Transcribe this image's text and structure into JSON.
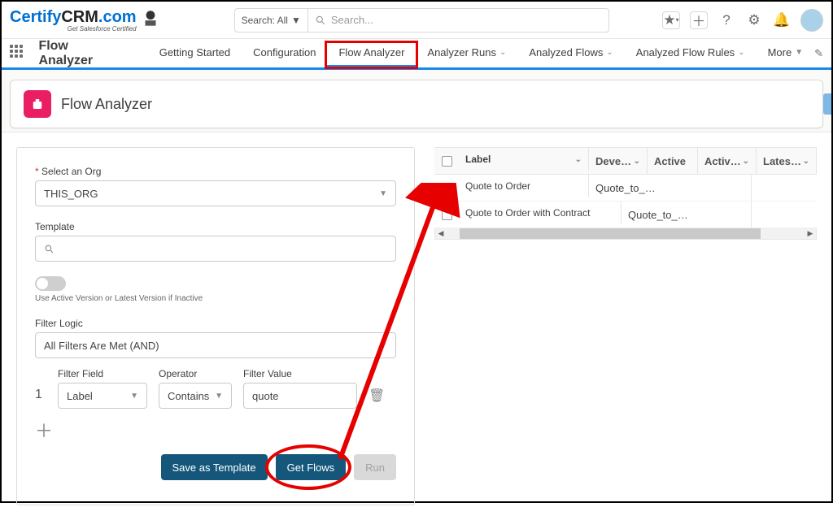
{
  "logo": {
    "brand_part1": "Certify",
    "brand_part2": "CRM",
    "brand_part3": ".com",
    "tagline": "Get Salesforce Certified"
  },
  "search": {
    "scope": "Search: All",
    "placeholder": "Search..."
  },
  "nav": {
    "app_name": "Flow Analyzer",
    "tabs": [
      {
        "label": "Getting Started",
        "dropdown": false,
        "active": false
      },
      {
        "label": "Configuration",
        "dropdown": false,
        "active": false
      },
      {
        "label": "Flow Analyzer",
        "dropdown": false,
        "active": true
      },
      {
        "label": "Analyzer Runs",
        "dropdown": true,
        "active": false
      },
      {
        "label": "Analyzed Flows",
        "dropdown": true,
        "active": false
      },
      {
        "label": "Analyzed Flow Rules",
        "dropdown": true,
        "active": false
      },
      {
        "label": "More",
        "dropdown": true,
        "active": false
      }
    ]
  },
  "page": {
    "title": "Flow Analyzer"
  },
  "form": {
    "org_label": "Select an Org",
    "org_value": "THIS_ORG",
    "template_label": "Template",
    "template_placeholder": "",
    "toggle_caption": "Use Active Version or Latest Version if Inactive",
    "filter_logic_label": "Filter Logic",
    "filter_logic_value": "All Filters Are Met (AND)",
    "row": {
      "num": "1",
      "field_label": "Filter Field",
      "field_value": "Label",
      "op_label": "Operator",
      "op_value": "Contains",
      "val_label": "Filter Value",
      "val_value": "quote"
    },
    "buttons": {
      "save": "Save as Template",
      "get": "Get Flows",
      "run": "Run"
    }
  },
  "table": {
    "headers": {
      "label": "Label",
      "dev": "Deve…",
      "active": "Active",
      "activ": "Activ…",
      "latest": "Lates…"
    },
    "rows": [
      {
        "label": "Quote to Order",
        "dev": "Quote_to_…"
      },
      {
        "label": "Quote to Order with Contract",
        "dev": "Quote_to_…"
      }
    ]
  }
}
